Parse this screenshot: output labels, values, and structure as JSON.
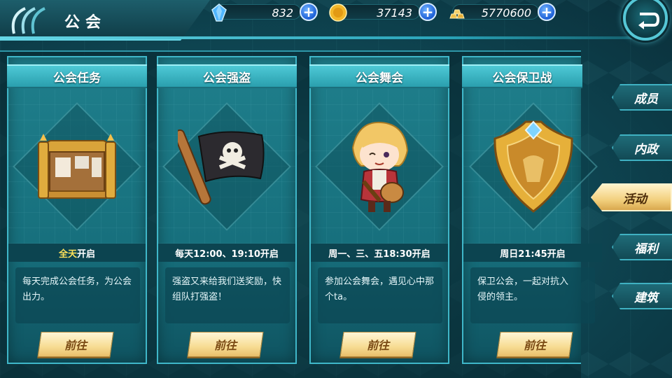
{
  "header": {
    "title": "公会",
    "resources": [
      {
        "name": "diamond",
        "icon": "blue-crystal-icon",
        "value": "832"
      },
      {
        "name": "gold",
        "icon": "gold-coin-icon",
        "value": "37143"
      },
      {
        "name": "bars",
        "icon": "gold-bars-icon",
        "value": "5770600"
      }
    ]
  },
  "cards": [
    {
      "title": "公会任务",
      "time_hl": "全天",
      "time_rest": "开启",
      "desc": "每天完成公会任务，为公会出力。",
      "button": "前往",
      "art": "bulletin-board"
    },
    {
      "title": "公会强盗",
      "time_hl": "",
      "time_rest": "每天12:00、19:10开启",
      "desc": "强盗又来给我们送奖励，快组队打强盗！",
      "button": "前往",
      "art": "pirate-flag"
    },
    {
      "title": "公会舞会",
      "time_hl": "",
      "time_rest": "周一、三、五18:30开启",
      "desc": "参加公会舞会，遇见心中那个ta。",
      "button": "前往",
      "art": "bard-character"
    },
    {
      "title": "公会保卫战",
      "time_hl": "",
      "time_rest": "周日21:45开启",
      "desc": "保卫公会，一起对抗入侵的领主。",
      "button": "前往",
      "art": "golden-shield"
    }
  ],
  "nav": [
    {
      "label": "成员",
      "active": false
    },
    {
      "label": "内政",
      "active": false
    },
    {
      "label": "活动",
      "active": true
    },
    {
      "label": "福利",
      "active": false
    },
    {
      "label": "建筑",
      "active": false
    }
  ],
  "colors": {
    "accent": "#3fb7c9",
    "highlight": "#ffe25a",
    "button_gold": "#f7dc93"
  }
}
